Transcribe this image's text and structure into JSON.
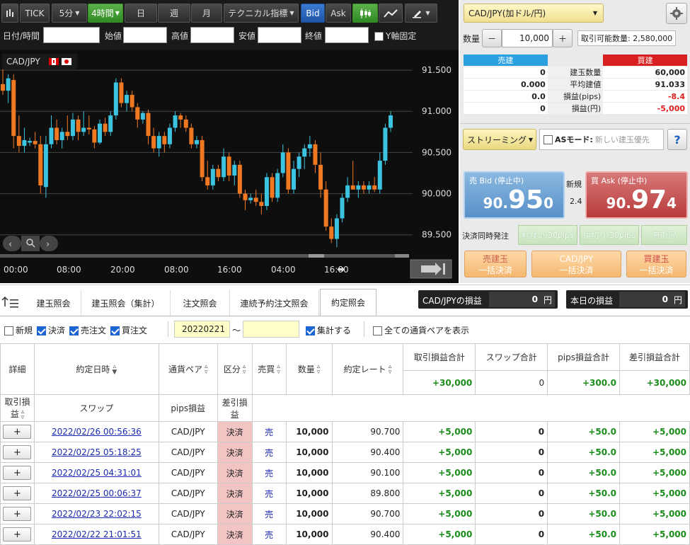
{
  "toolbar": {
    "tick": "TICK",
    "interval": "5分",
    "interval_active": "4時間",
    "day": "日",
    "week": "週",
    "month": "月",
    "indicator": "テクニカル指標",
    "bid": "Bid",
    "ask": "Ask"
  },
  "info_bar": {
    "datetime_label": "日付/時間",
    "open_label": "始値",
    "high_label": "高値",
    "low_label": "安値",
    "close_label": "終値",
    "yaxis_fix_label": "Y軸固定"
  },
  "chart": {
    "symbol": "CAD/JPY",
    "y_ticks": [
      "91.500",
      "91.000",
      "90.500",
      "90.000",
      "89.500"
    ],
    "x_ticks": [
      "00:00",
      "08:00",
      "20:00",
      "08:00",
      "16:00",
      "04:00",
      "16:00"
    ],
    "up_color": "#3cc3e0",
    "down_color": "#f07820"
  },
  "chart_data": {
    "type": "candlestick",
    "ylim": [
      89.3,
      91.75
    ],
    "candles": [
      {
        "o": 91.33,
        "h": 91.55,
        "l": 91.2,
        "c": 91.25
      },
      {
        "o": 91.25,
        "h": 91.45,
        "l": 91.1,
        "c": 91.4
      },
      {
        "o": 91.38,
        "h": 91.45,
        "l": 90.55,
        "c": 90.7
      },
      {
        "o": 90.7,
        "h": 90.95,
        "l": 90.5,
        "c": 90.58
      },
      {
        "o": 90.58,
        "h": 90.8,
        "l": 90.5,
        "c": 90.65
      },
      {
        "o": 90.62,
        "h": 90.68,
        "l": 90.58,
        "c": 90.64
      },
      {
        "o": 90.64,
        "h": 90.75,
        "l": 90.55,
        "c": 90.6
      },
      {
        "o": 90.6,
        "h": 90.7,
        "l": 90.0,
        "c": 90.1
      },
      {
        "o": 90.08,
        "h": 90.7,
        "l": 89.95,
        "c": 90.6
      },
      {
        "o": 90.6,
        "h": 90.95,
        "l": 90.55,
        "c": 90.8
      },
      {
        "o": 90.8,
        "h": 90.9,
        "l": 90.6,
        "c": 90.65
      },
      {
        "o": 90.65,
        "h": 90.8,
        "l": 90.55,
        "c": 90.75
      },
      {
        "o": 90.75,
        "h": 90.95,
        "l": 90.65,
        "c": 90.7
      },
      {
        "o": 90.7,
        "h": 90.98,
        "l": 90.65,
        "c": 90.9
      },
      {
        "o": 90.9,
        "h": 90.95,
        "l": 90.65,
        "c": 90.75
      },
      {
        "o": 90.75,
        "h": 91.0,
        "l": 90.7,
        "c": 90.8
      },
      {
        "o": 90.8,
        "h": 90.95,
        "l": 90.72,
        "c": 90.78
      },
      {
        "o": 90.78,
        "h": 90.82,
        "l": 90.55,
        "c": 90.62
      },
      {
        "o": 90.62,
        "h": 90.9,
        "l": 90.6,
        "c": 90.85
      },
      {
        "o": 90.85,
        "h": 90.92,
        "l": 90.7,
        "c": 90.75
      },
      {
        "o": 90.75,
        "h": 91.0,
        "l": 90.7,
        "c": 90.95
      },
      {
        "o": 90.95,
        "h": 91.4,
        "l": 90.9,
        "c": 91.35
      },
      {
        "o": 91.35,
        "h": 91.4,
        "l": 91.05,
        "c": 91.1
      },
      {
        "o": 91.1,
        "h": 91.25,
        "l": 91.0,
        "c": 91.2
      },
      {
        "o": 91.2,
        "h": 91.25,
        "l": 91.0,
        "c": 91.05
      },
      {
        "o": 91.05,
        "h": 91.1,
        "l": 90.8,
        "c": 90.9
      },
      {
        "o": 90.9,
        "h": 91.0,
        "l": 90.85,
        "c": 90.98
      },
      {
        "o": 90.98,
        "h": 91.02,
        "l": 90.6,
        "c": 90.7
      },
      {
        "o": 90.7,
        "h": 90.8,
        "l": 90.5,
        "c": 90.55
      },
      {
        "o": 90.55,
        "h": 90.75,
        "l": 90.45,
        "c": 90.7
      },
      {
        "o": 90.7,
        "h": 90.75,
        "l": 90.5,
        "c": 90.6
      },
      {
        "o": 90.6,
        "h": 90.85,
        "l": 90.55,
        "c": 90.8
      },
      {
        "o": 90.8,
        "h": 91.0,
        "l": 90.75,
        "c": 90.95
      },
      {
        "o": 90.95,
        "h": 90.98,
        "l": 90.8,
        "c": 90.9
      },
      {
        "o": 90.9,
        "h": 90.95,
        "l": 90.75,
        "c": 90.8
      },
      {
        "o": 90.8,
        "h": 90.85,
        "l": 90.55,
        "c": 90.6
      },
      {
        "o": 90.6,
        "h": 90.7,
        "l": 90.55,
        "c": 90.65
      },
      {
        "o": 90.65,
        "h": 90.7,
        "l": 90.15,
        "c": 90.2
      },
      {
        "o": 90.2,
        "h": 90.4,
        "l": 90.05,
        "c": 90.1
      },
      {
        "o": 90.1,
        "h": 90.35,
        "l": 90.05,
        "c": 90.3
      },
      {
        "o": 90.3,
        "h": 90.35,
        "l": 90.15,
        "c": 90.2
      },
      {
        "o": 90.2,
        "h": 90.55,
        "l": 90.15,
        "c": 90.45
      },
      {
        "o": 90.45,
        "h": 90.5,
        "l": 90.15,
        "c": 90.22
      },
      {
        "o": 90.22,
        "h": 90.4,
        "l": 90.1,
        "c": 90.35
      },
      {
        "o": 90.35,
        "h": 90.4,
        "l": 89.95,
        "c": 90.0
      },
      {
        "o": 90.0,
        "h": 90.05,
        "l": 89.8,
        "c": 89.92
      },
      {
        "o": 89.92,
        "h": 90.0,
        "l": 89.88,
        "c": 89.95
      },
      {
        "o": 89.95,
        "h": 90.05,
        "l": 89.85,
        "c": 89.9
      },
      {
        "o": 89.9,
        "h": 90.0,
        "l": 89.75,
        "c": 89.85
      },
      {
        "o": 89.85,
        "h": 90.25,
        "l": 89.8,
        "c": 90.2
      },
      {
        "o": 90.2,
        "h": 90.25,
        "l": 89.9,
        "c": 89.95
      },
      {
        "o": 89.95,
        "h": 90.3,
        "l": 89.9,
        "c": 90.25
      },
      {
        "o": 90.25,
        "h": 90.6,
        "l": 90.2,
        "c": 90.5
      },
      {
        "o": 90.5,
        "h": 90.55,
        "l": 90.0,
        "c": 90.05
      },
      {
        "o": 90.05,
        "h": 90.4,
        "l": 90.0,
        "c": 90.3
      },
      {
        "o": 90.3,
        "h": 90.5,
        "l": 90.2,
        "c": 90.45
      },
      {
        "o": 90.45,
        "h": 90.6,
        "l": 90.3,
        "c": 90.55
      },
      {
        "o": 90.55,
        "h": 90.7,
        "l": 90.45,
        "c": 90.6
      },
      {
        "o": 90.6,
        "h": 90.65,
        "l": 90.25,
        "c": 90.35
      },
      {
        "o": 90.35,
        "h": 90.5,
        "l": 89.95,
        "c": 90.05
      },
      {
        "o": 90.05,
        "h": 90.15,
        "l": 89.55,
        "c": 89.6
      },
      {
        "o": 89.6,
        "h": 89.7,
        "l": 89.4,
        "c": 89.45
      },
      {
        "o": 89.45,
        "h": 89.75,
        "l": 89.35,
        "c": 89.7
      },
      {
        "o": 89.7,
        "h": 90.0,
        "l": 89.65,
        "c": 89.95
      },
      {
        "o": 89.95,
        "h": 90.2,
        "l": 89.9,
        "c": 90.1
      },
      {
        "o": 90.1,
        "h": 90.4,
        "l": 90.05,
        "c": 90.05
      },
      {
        "o": 90.05,
        "h": 90.15,
        "l": 89.95,
        "c": 90.1
      },
      {
        "o": 90.1,
        "h": 90.15,
        "l": 90.0,
        "c": 90.05
      },
      {
        "o": 90.05,
        "h": 90.15,
        "l": 90.0,
        "c": 90.1
      },
      {
        "o": 90.1,
        "h": 90.2,
        "l": 90.02,
        "c": 90.05
      },
      {
        "o": 90.05,
        "h": 90.5,
        "l": 90.0,
        "c": 90.4
      },
      {
        "o": 90.4,
        "h": 90.85,
        "l": 90.35,
        "c": 90.8
      },
      {
        "o": 90.8,
        "h": 91.0,
        "l": 90.75,
        "c": 90.95
      }
    ]
  },
  "order": {
    "pair": "CAD/JPY(加ドル/円)",
    "qty_label": "数量",
    "qty_value": "10,000",
    "minus": "－",
    "plus": "＋",
    "available": "取引可能数量: 2,580,000"
  },
  "positions": {
    "sell_header": "売建",
    "buy_header": "買建",
    "rows": [
      {
        "sell": "0",
        "label": "建玉数量",
        "buy": "60,000",
        "neg": false
      },
      {
        "sell": "0.000",
        "label": "平均建値",
        "buy": "91.033",
        "neg": false
      },
      {
        "sell": "0.0",
        "label": "損益(pips)",
        "buy": "-8.4",
        "neg": true
      },
      {
        "sell": "0",
        "label": "損益(円)",
        "buy": "-5,000",
        "neg": true
      }
    ]
  },
  "streaming": {
    "label": "ストリーミング",
    "as_mode": "ASモード:",
    "as_mode_value": "新しい建玉優先",
    "help": "?"
  },
  "quote": {
    "bid_label": "売 Bid (停止中)",
    "bid_main": "90.",
    "bid_big": "95",
    "bid_small": "0",
    "ask_label": "買 Ask (停止中)",
    "ask_main": "90.",
    "ask_big": "97",
    "ask_small": "4",
    "spread_label": "新規",
    "spread_value": "2.4"
  },
  "settle": {
    "label": "決済同時発注",
    "profit": "利食い:30pips",
    "loss": "損切り:30pips",
    "unlimited": "無期限",
    "sell_all_1": "売建玉",
    "sell_all_2": "一括決済",
    "pair_all_1": "CAD/JPY",
    "pair_all_2": "一括決済",
    "buy_all_1": "買建玉",
    "buy_all_2": "一括決済"
  },
  "tabs": [
    "建玉照会",
    "建玉照会（集計）",
    "注文照会",
    "連続予約注文照会",
    "約定照会"
  ],
  "pnl": {
    "pair_label": "CAD/JPYの損益",
    "pair_value": "0",
    "pair_unit": "円",
    "today_label": "本日の損益",
    "today_value": "0",
    "today_unit": "円"
  },
  "filters": {
    "new": "新規",
    "settle": "決済",
    "sell_order": "売注文",
    "buy_order": "買注文",
    "date_from": "20220221",
    "tilde": "〜",
    "date_to": "",
    "aggregate": "集計する",
    "all_pairs": "全ての通貨ペアを表示"
  },
  "grid": {
    "headers": {
      "detail": "詳細",
      "datetime": "約定日時",
      "pair": "通貨ペア",
      "kind": "区分",
      "side": "売買",
      "qty": "数量",
      "rate": "約定レート",
      "pnl_total": "取引損益合計",
      "swap_total": "スワップ合計",
      "pips_total": "pips損益合計",
      "net_total": "差引損益合計",
      "pnl": "取引損益",
      "swap": "スワップ",
      "pips": "pips損益",
      "net": "差引損益"
    },
    "totals": {
      "pnl": "+30,000",
      "swap": "0",
      "pips": "+300.0",
      "net": "+30,000"
    },
    "rows": [
      {
        "dt": "2022/02/26 00:56:36",
        "pair": "CAD/JPY",
        "kind": "決済",
        "side": "売",
        "qty": "10,000",
        "rate": "90.700",
        "pnl": "+5,000",
        "swap": "0",
        "pips": "+50.0",
        "net": "+5,000"
      },
      {
        "dt": "2022/02/25 05:18:25",
        "pair": "CAD/JPY",
        "kind": "決済",
        "side": "売",
        "qty": "10,000",
        "rate": "90.400",
        "pnl": "+5,000",
        "swap": "0",
        "pips": "+50.0",
        "net": "+5,000"
      },
      {
        "dt": "2022/02/25 04:31:01",
        "pair": "CAD/JPY",
        "kind": "決済",
        "side": "売",
        "qty": "10,000",
        "rate": "90.100",
        "pnl": "+5,000",
        "swap": "0",
        "pips": "+50.0",
        "net": "+5,000"
      },
      {
        "dt": "2022/02/25 00:06:37",
        "pair": "CAD/JPY",
        "kind": "決済",
        "side": "売",
        "qty": "10,000",
        "rate": "89.800",
        "pnl": "+5,000",
        "swap": "0",
        "pips": "+50.0",
        "net": "+5,000"
      },
      {
        "dt": "2022/02/23 22:02:15",
        "pair": "CAD/JPY",
        "kind": "決済",
        "side": "売",
        "qty": "10,000",
        "rate": "90.700",
        "pnl": "+5,000",
        "swap": "0",
        "pips": "+50.0",
        "net": "+5,000"
      },
      {
        "dt": "2022/02/22 21:01:51",
        "pair": "CAD/JPY",
        "kind": "決済",
        "side": "売",
        "qty": "10,000",
        "rate": "90.400",
        "pnl": "+5,000",
        "swap": "0",
        "pips": "+50.0",
        "net": "+5,000"
      }
    ]
  }
}
